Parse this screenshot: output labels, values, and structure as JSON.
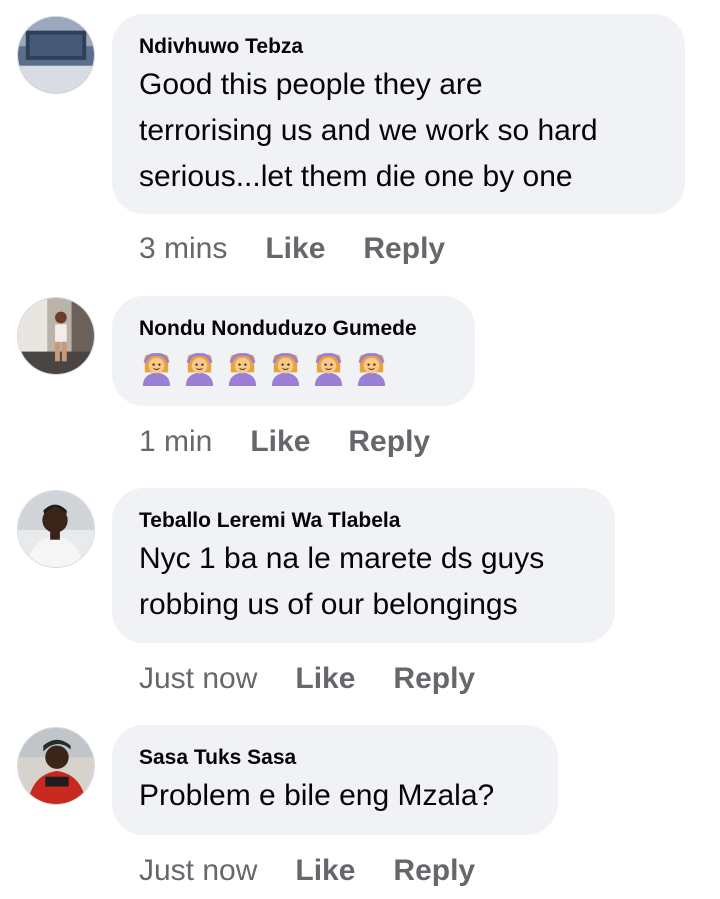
{
  "comments": [
    {
      "author": "Ndivhuwo Tebza",
      "text_lines": [
        "Good this people they are",
        "terrorising us and we work so hard",
        "serious...let them die one by one"
      ],
      "time": "3 mins",
      "like_label": "Like",
      "reply_label": "Reply"
    },
    {
      "author": "Nondu Nonduduzo Gumede",
      "emojis": [
        "person-gesturing-ok",
        "person-gesturing-ok",
        "person-gesturing-ok",
        "person-gesturing-ok",
        "person-gesturing-ok",
        "person-gesturing-ok"
      ],
      "time": "1 min",
      "like_label": "Like",
      "reply_label": "Reply"
    },
    {
      "author": "Teballo Leremi Wa Tlabela",
      "text_lines": [
        "Nyc 1 ba na le marete ds guys",
        "robbing us of our belongings"
      ],
      "time": "Just now",
      "like_label": "Like",
      "reply_label": "Reply"
    },
    {
      "author": "Sasa Tuks Sasa",
      "text_lines": [
        "Problem e bile eng Mzala?"
      ],
      "time": "Just now",
      "like_label": "Like",
      "reply_label": "Reply"
    }
  ]
}
